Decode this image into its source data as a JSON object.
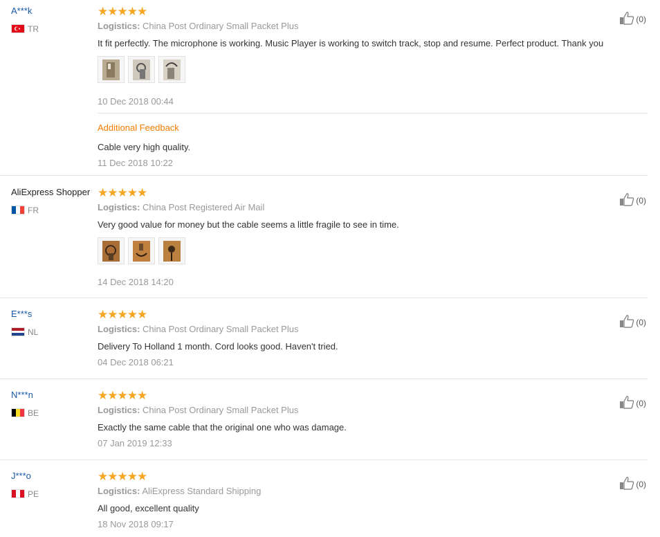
{
  "reviews": [
    {
      "user": "A***k",
      "country": "TR",
      "stars": "★★★★★",
      "logistics_label": "Logistics:",
      "logistics": "China Post Ordinary Small Packet Plus",
      "text": "It fit perfectly. The microphone is working. Music Player is working to switch track, stop and resume. Perfect product. Thank you",
      "date": "10 Dec 2018 00:44",
      "helpful_count": "(0)",
      "photo_count": 3,
      "additional": {
        "title": "Additional Feedback",
        "text": "Cable very high quality.",
        "date": "11 Dec 2018 10:22"
      }
    },
    {
      "user": "AliExpress Shopper",
      "country": "FR",
      "stars": "★★★★★",
      "logistics_label": "Logistics:",
      "logistics": "China Post Registered Air Mail",
      "text": "Very good value for money but the cable seems a little fragile to see in time.",
      "date": "14 Dec 2018 14:20",
      "helpful_count": "(0)",
      "photo_count": 3
    },
    {
      "user": "E***s",
      "country": "NL",
      "stars": "★★★★★",
      "logistics_label": "Logistics:",
      "logistics": "China Post Ordinary Small Packet Plus",
      "text": "Delivery To Holland 1 month. Cord looks good. Haven't tried.",
      "date": "04 Dec 2018 06:21",
      "helpful_count": "(0)"
    },
    {
      "user": "N***n",
      "country": "BE",
      "stars": "★★★★★",
      "logistics_label": "Logistics:",
      "logistics": "China Post Ordinary Small Packet Plus",
      "text": "Exactly the same cable that the original one who was damage.",
      "date": "07 Jan 2019 12:33",
      "helpful_count": "(0)"
    },
    {
      "user": "J***o",
      "country": "PE",
      "stars": "★★★★★",
      "logistics_label": "Logistics:",
      "logistics": "AliExpress Standard Shipping",
      "text": "All good, excellent quality",
      "date": "18 Nov 2018 09:17",
      "helpful_count": "(0)"
    }
  ],
  "colors": {
    "username": "#1a58a8",
    "stars": "#f5a623",
    "additional_feedback": "#f57c00",
    "muted": "#999999"
  },
  "icons": {
    "helpful": "thumbs-up-icon",
    "rating": "star-icon",
    "photo": "review-photo"
  }
}
